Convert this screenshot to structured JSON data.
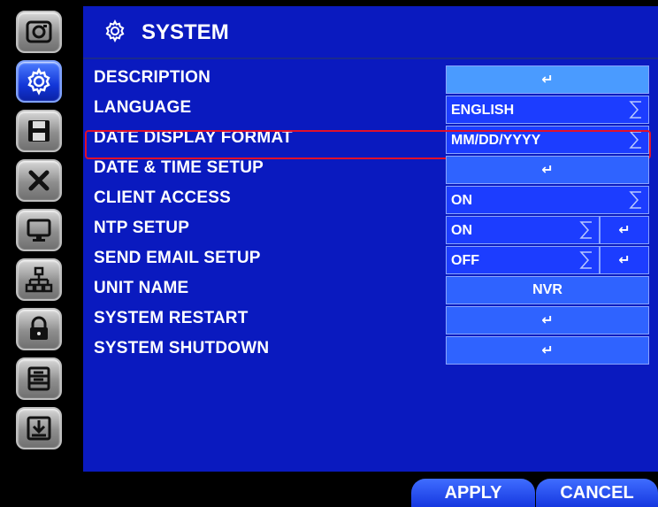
{
  "header": {
    "title": "SYSTEM"
  },
  "rail": {
    "icons": [
      "camera-icon",
      "gear-icon",
      "floppy-disk-icon",
      "tools-icon",
      "monitor-icon",
      "network-icon",
      "lock-icon",
      "storage-icon",
      "download-icon"
    ],
    "active": "gear-icon"
  },
  "rows": [
    {
      "label": "DESCRIPTION",
      "control": "enter"
    },
    {
      "label": "LANGUAGE",
      "value": "ENGLISH"
    },
    {
      "label": "DATE DISPLAY FORMAT",
      "value": "MM/DD/YYYY"
    },
    {
      "label": "DATE & TIME SETUP",
      "control": "enter"
    },
    {
      "label": "CLIENT ACCESS",
      "value": "ON"
    },
    {
      "label": "NTP SETUP",
      "value": "ON"
    },
    {
      "label": "SEND EMAIL SETUP",
      "value": "OFF"
    },
    {
      "label": "UNIT NAME",
      "value": "NVR"
    },
    {
      "label": "SYSTEM RESTART",
      "control": "enter"
    },
    {
      "label": "SYSTEM SHUTDOWN",
      "control": "enter"
    }
  ],
  "footer": {
    "apply_label": "APPLY",
    "cancel_label": "CANCEL"
  },
  "colors": {
    "panel": "#0a1abf",
    "button": "#2f63ff",
    "highlight": "#e2102a"
  }
}
